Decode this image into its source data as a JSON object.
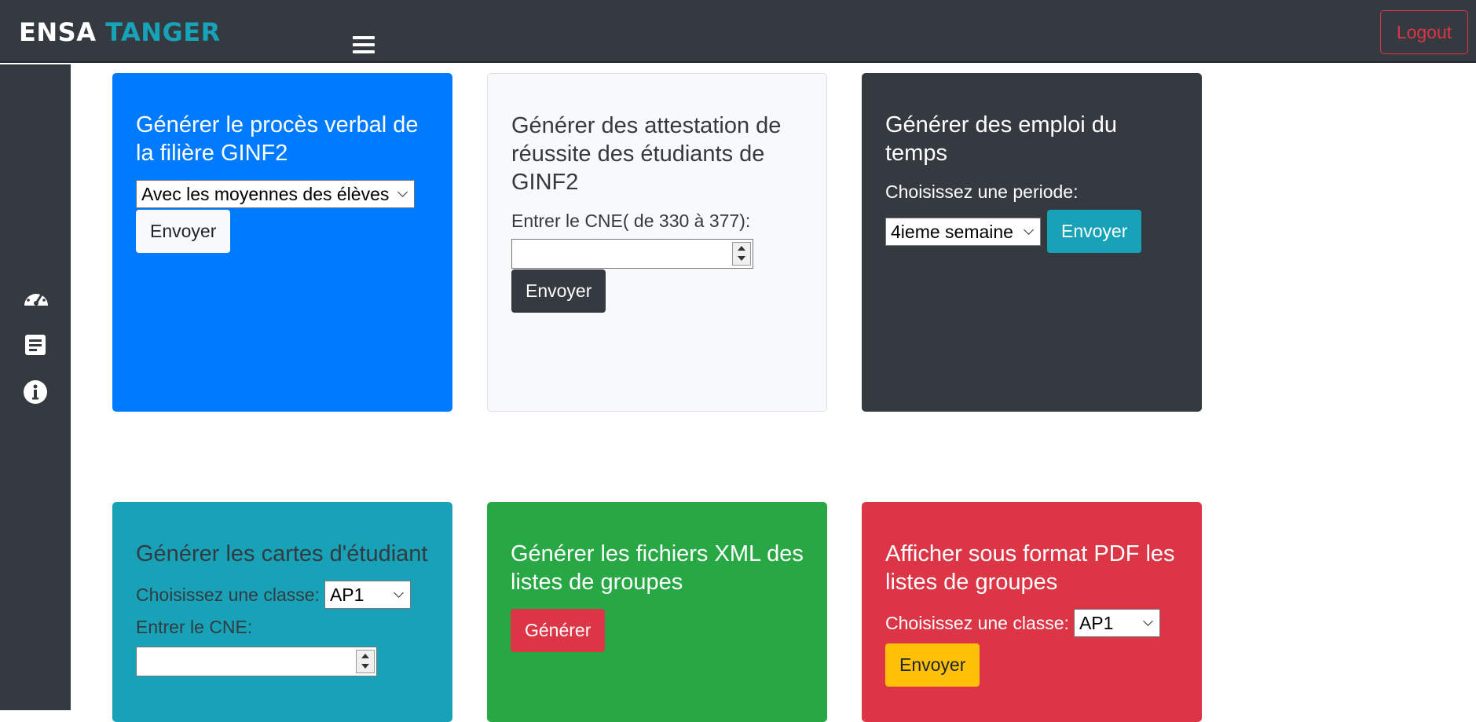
{
  "header": {
    "brand_part1": "ENSA",
    "brand_part2": "TANGER",
    "logout_label": "Logout"
  },
  "sidebar": {
    "icons": [
      "dashboard-icon",
      "document-icon",
      "info-icon"
    ]
  },
  "cards": {
    "pv": {
      "title": "Générer le procès verbal de la filière GINF2",
      "select_value": "Avec les moyennes des élèves",
      "button": "Envoyer"
    },
    "attestation": {
      "title": "Générer des attestation de réussite des étudiants de GINF2",
      "input_label": "Entrer le CNE( de 330 à 377):",
      "input_value": "",
      "button": "Envoyer"
    },
    "emploi": {
      "title": "Générer des emploi du temps",
      "period_label": "Choisissez une periode:",
      "select_value": "4ieme semaine",
      "button": "Envoyer"
    },
    "cartes": {
      "title": "Générer les cartes d'étudiant",
      "class_label": "Choisissez une classe:",
      "select_value": "AP1",
      "cne_label": "Entrer le CNE:",
      "cne_value": ""
    },
    "xml": {
      "title": "Générer les fichiers XML des listes de groupes",
      "button": "Générer"
    },
    "pdf": {
      "title": "Afficher sous format PDF les listes de groupes",
      "class_label": "Choisissez une classe:",
      "select_value": "AP1",
      "button": "Envoyer"
    }
  },
  "colors": {
    "primary": "#007bff",
    "light": "#f8f9fa",
    "dark": "#343a40",
    "info": "#17a2b8",
    "success": "#28a745",
    "danger": "#dc3545",
    "warning": "#ffc107"
  }
}
